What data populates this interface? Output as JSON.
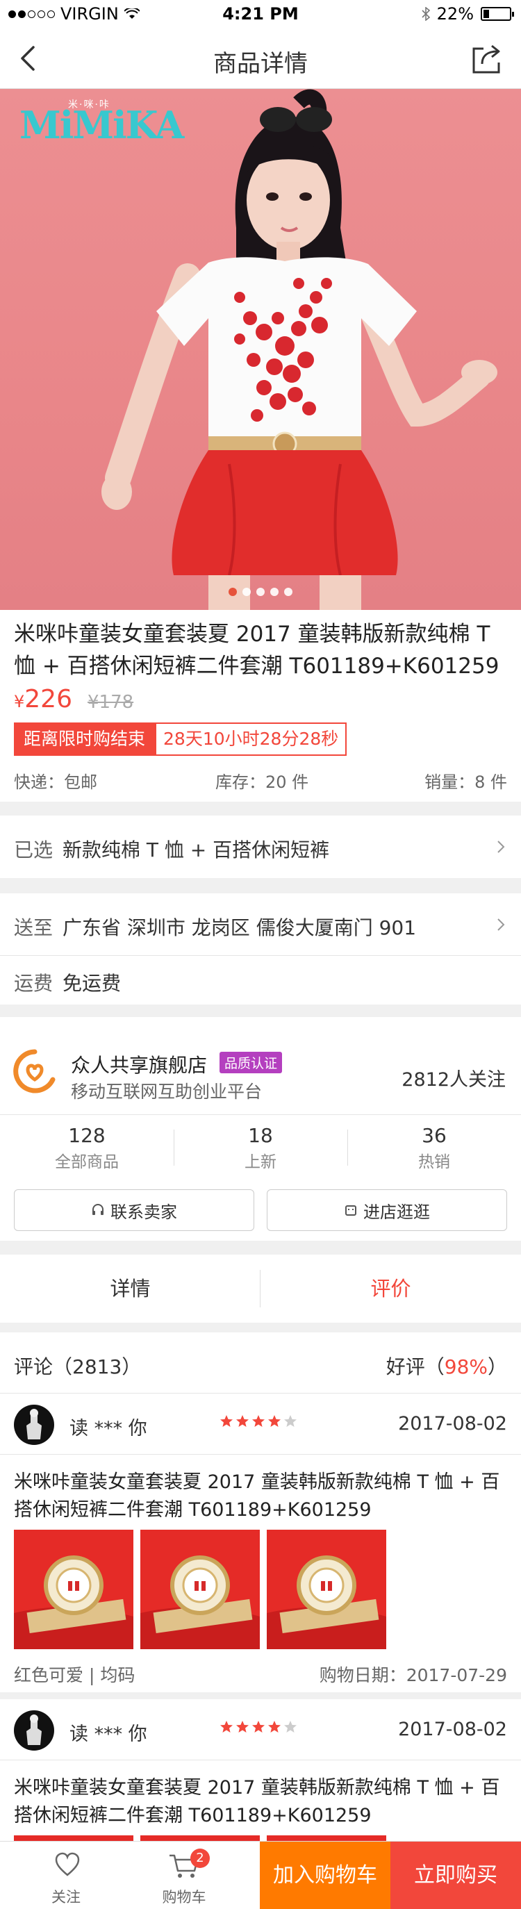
{
  "status_bar": {
    "carrier": "VIRGIN",
    "time": "4:21 PM",
    "battery": "22%",
    "signal_bars": 2,
    "battery_level": 0.22
  },
  "nav": {
    "title": "商品详情",
    "back_icon": "chevron-left-icon",
    "share_icon": "share-icon"
  },
  "hero": {
    "brand_logo": "MiMiKA",
    "brand_cn": "米·咪·咔",
    "pages": 5,
    "active_page": 0
  },
  "product": {
    "name": "米咪咔童装女童套装夏 2017 童装韩版新款纯棉 T 恤 + 百搭休闲短裤二件套潮 T601189+K601259",
    "currency": "¥",
    "price": "226",
    "old_price": "¥178",
    "limit_label": "距离限时购结束",
    "limit_time": "28天10小时28分28秒",
    "shipping": "快递：包邮",
    "stock": "库存：20 件",
    "sales": "销量：8 件"
  },
  "selected": {
    "key": "已选",
    "value": "新款纯棉 T 恤 + 百搭休闲短裤"
  },
  "deliver": {
    "key": "送至",
    "value": "广东省 深圳市 龙岗区 儒俊大厦南门 901"
  },
  "freight": {
    "key": "运费",
    "value": "免运费"
  },
  "shop": {
    "name": "众人共享旗舰店",
    "badge": "品质认证",
    "desc": "移动互联网互助创业平台",
    "followers": "2812人关注",
    "stats": [
      {
        "num": "128",
        "label": "全部商品"
      },
      {
        "num": "18",
        "label": "上新"
      },
      {
        "num": "36",
        "label": "热销"
      }
    ],
    "contact_label": "联系卖家",
    "visit_label": "进店逛逛"
  },
  "tabs": {
    "details": "详情",
    "reviews": "评价",
    "active": "reviews"
  },
  "reviews_header": {
    "title": "评论（2813）",
    "good_prefix": "好评（",
    "good_rate": "98%",
    "good_suffix": "）"
  },
  "reviews": [
    {
      "user": "读 *** 你",
      "rating": 4,
      "date": "2017-08-02",
      "text": "米咪咔童装女童套装夏 2017 童装韩版新款纯棉 T 恤 + 百搭休闲短裤二件套潮 T601189+K601259",
      "spec": "红色可爱 | 均码",
      "purchase_date": "购物日期：2017-07-29"
    },
    {
      "user": "读 *** 你",
      "rating": 4,
      "date": "2017-08-02",
      "text": "米咪咔童装女童套装夏 2017 童装韩版新款纯棉 T 恤 + 百搭休闲短裤二件套潮 T601189+K601259"
    }
  ],
  "bottom_bar": {
    "favorite": "关注",
    "cart": "购物车",
    "cart_count": "2",
    "add_to_cart": "加入购物车",
    "buy_now": "立即购买"
  },
  "colors": {
    "accent_red": "#f2473b",
    "accent_orange": "#ff7a00",
    "badge_purple": "#b43fbf",
    "hero_pink": "#ec8f92"
  }
}
